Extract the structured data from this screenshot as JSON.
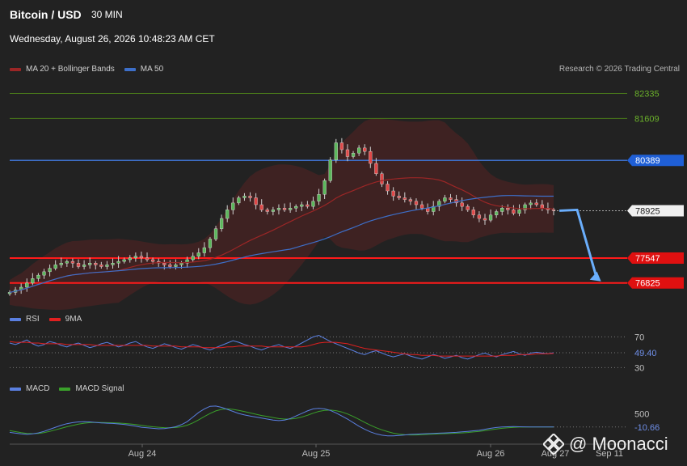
{
  "header": {
    "title": "Bitcoin / USD",
    "timeframe": "30 MIN",
    "timestamp": "Wednesday, August 26, 2026 10:48:23 AM CET"
  },
  "legend_main": [
    {
      "label": "MA 20 + Bollinger Bands",
      "color": "#9b2626"
    },
    {
      "label": "MA 50",
      "color": "#3d6fc9"
    }
  ],
  "legend_rsi": [
    {
      "label": "RSI",
      "color": "#5a7fe0"
    },
    {
      "label": "9MA",
      "color": "#e02020"
    }
  ],
  "legend_macd": [
    {
      "label": "MACD",
      "color": "#5a7fe0"
    },
    {
      "label": "MACD Signal",
      "color": "#3aa02a"
    }
  ],
  "credit": "Research © 2026 Trading Central",
  "watermark": "@ Moonacci",
  "colors": {
    "background": "#222222",
    "up_candle": "#5cb85c",
    "down_candle": "#e04848",
    "band_fill": "#4a2222",
    "resistance_line": "#3d6fc9",
    "support_line": "#ff1a1a",
    "target_line": "#4a7a1a",
    "projection_arrow": "#6aaefc"
  },
  "chart_data": [
    {
      "type": "candlestick",
      "title": "",
      "x_ticks": [
        "Aug 24",
        "Aug 25",
        "Aug 26",
        "Aug 27",
        "Sep 11"
      ],
      "ylim": [
        76300,
        82700
      ],
      "levels": [
        {
          "value": 82335,
          "label": "82335",
          "kind": "target"
        },
        {
          "value": 81609,
          "label": "81609",
          "kind": "target"
        },
        {
          "value": 80389,
          "label": "80389",
          "kind": "resistance"
        },
        {
          "value": 78925,
          "label": "78925",
          "kind": "last"
        },
        {
          "value": 77547,
          "label": "77547",
          "kind": "support"
        },
        {
          "value": 76825,
          "label": "76825",
          "kind": "support"
        }
      ],
      "close_series": [
        76550,
        76620,
        76700,
        76820,
        76950,
        77050,
        77150,
        77250,
        77350,
        77400,
        77450,
        77400,
        77300,
        77350,
        77400,
        77350,
        77300,
        77350,
        77400,
        77450,
        77500,
        77550,
        77600,
        77550,
        77500,
        77450,
        77400,
        77350,
        77300,
        77350,
        77400,
        77500,
        77600,
        77700,
        77850,
        78100,
        78400,
        78700,
        78950,
        79150,
        79300,
        79350,
        79300,
        79100,
        78950,
        78900,
        78950,
        79000,
        78950,
        79000,
        79050,
        79100,
        79050,
        79200,
        79400,
        79800,
        80400,
        80900,
        80700,
        80500,
        80600,
        80750,
        80650,
        80300,
        80000,
        79700,
        79500,
        79350,
        79300,
        79250,
        79200,
        79100,
        79000,
        78900,
        79050,
        79200,
        79300,
        79250,
        79150,
        79050,
        78950,
        78800,
        78700,
        78650,
        78800,
        78900,
        79000,
        78950,
        78850,
        78950,
        79100,
        79150,
        79100,
        79000,
        78950,
        78925
      ],
      "projection": [
        {
          "x_index": 96,
          "value": 78925
        },
        {
          "x_index": 103,
          "value": 76825
        }
      ]
    },
    {
      "type": "line",
      "title": "",
      "levels": [
        70,
        49.4,
        30
      ],
      "level_labels": [
        "70",
        "49.40",
        "30"
      ],
      "ylim": [
        22,
        82
      ],
      "series": [
        {
          "name": "RSI",
          "values": [
            62,
            60,
            63,
            66,
            61,
            58,
            60,
            64,
            62,
            59,
            57,
            60,
            62,
            59,
            56,
            58,
            61,
            63,
            60,
            57,
            59,
            62,
            64,
            60,
            57,
            55,
            58,
            61,
            59,
            56,
            54,
            57,
            60,
            58,
            55,
            53,
            56,
            59,
            62,
            65,
            63,
            60,
            58,
            55,
            53,
            56,
            58,
            60,
            57,
            55,
            58,
            62,
            66,
            70,
            72,
            68,
            64,
            61,
            58,
            55,
            52,
            49,
            47,
            50,
            52,
            49,
            46,
            44,
            46,
            48,
            45,
            43,
            41,
            44,
            47,
            45,
            42,
            44,
            46,
            43,
            41,
            44,
            47,
            49,
            46,
            44,
            47,
            49,
            51,
            48,
            46,
            49,
            50,
            49,
            48,
            49.4
          ]
        },
        {
          "name": "9MA",
          "values": [
            64,
            63,
            63,
            63,
            62,
            62,
            61,
            61,
            61,
            61,
            60,
            60,
            60,
            60,
            60,
            59,
            59,
            59,
            59,
            59,
            59,
            59,
            59,
            59,
            59,
            58,
            58,
            58,
            58,
            58,
            57,
            57,
            57,
            57,
            56,
            56,
            56,
            56,
            57,
            57,
            58,
            58,
            58,
            58,
            58,
            57,
            57,
            57,
            57,
            57,
            57,
            57,
            58,
            60,
            62,
            63,
            63,
            63,
            62,
            61,
            59,
            57,
            55,
            54,
            53,
            52,
            51,
            50,
            49,
            48,
            47,
            47,
            46,
            46,
            46,
            45,
            45,
            45,
            45,
            45,
            45,
            45,
            45,
            45,
            45,
            45,
            46,
            46,
            46,
            47,
            47,
            47,
            48,
            48,
            48,
            48.6
          ]
        }
      ]
    },
    {
      "type": "line",
      "title": "",
      "levels": [
        500,
        -10.66
      ],
      "level_labels": [
        "500",
        "-10.66"
      ],
      "ylim": [
        -650,
        1250
      ],
      "series": [
        {
          "name": "MACD",
          "values": [
            -220,
            -250,
            -280,
            -300,
            -280,
            -240,
            -180,
            -100,
            -20,
            60,
            120,
            160,
            190,
            200,
            190,
            170,
            150,
            140,
            130,
            110,
            90,
            60,
            20,
            -20,
            -40,
            -60,
            -80,
            -70,
            -40,
            0,
            80,
            200,
            380,
            560,
            700,
            800,
            810,
            760,
            680,
            600,
            520,
            460,
            420,
            380,
            340,
            300,
            260,
            240,
            260,
            320,
            420,
            520,
            620,
            700,
            720,
            700,
            640,
            540,
            420,
            300,
            160,
            20,
            -100,
            -200,
            -280,
            -330,
            -360,
            -360,
            -340,
            -320,
            -300,
            -290,
            -280,
            -270,
            -260,
            -250,
            -240,
            -230,
            -220,
            -200,
            -180,
            -160,
            -140,
            -100,
            -60,
            -30,
            -10,
            0,
            5,
            0,
            -5,
            -10,
            -10,
            -10,
            -10,
            -10.66
          ]
        },
        {
          "name": "MACD Signal",
          "values": [
            -150,
            -190,
            -230,
            -260,
            -270,
            -260,
            -230,
            -180,
            -120,
            -60,
            0,
            50,
            100,
            140,
            160,
            170,
            168,
            162,
            155,
            145,
            130,
            110,
            85,
            55,
            25,
            0,
            -20,
            -35,
            -40,
            -30,
            0,
            60,
            150,
            270,
            400,
            520,
            620,
            680,
            700,
            680,
            640,
            590,
            540,
            490,
            440,
            400,
            360,
            320,
            300,
            300,
            330,
            380,
            450,
            530,
            600,
            640,
            650,
            630,
            580,
            500,
            400,
            290,
            170,
            60,
            -40,
            -120,
            -190,
            -250,
            -290,
            -310,
            -320,
            -320,
            -310,
            -300,
            -290,
            -280,
            -270,
            -260,
            -250,
            -240,
            -225,
            -205,
            -180,
            -150,
            -120,
            -90,
            -60,
            -40,
            -25,
            -15,
            -12,
            -11,
            -10,
            -10,
            -10.5,
            -10.66
          ]
        }
      ]
    }
  ]
}
